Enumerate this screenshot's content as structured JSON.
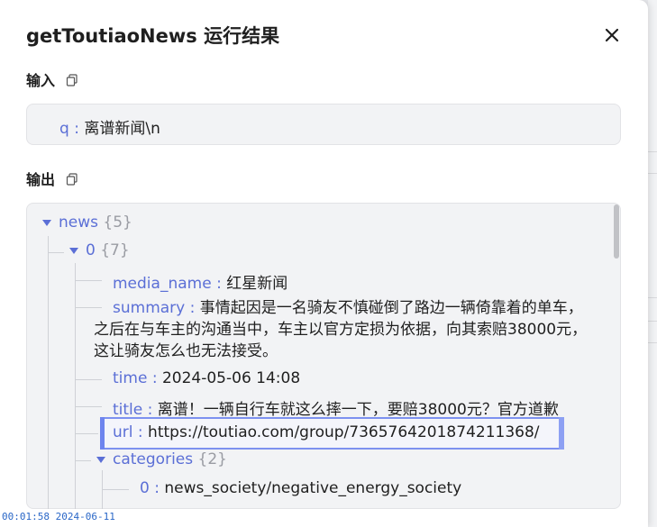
{
  "dialog": {
    "title": "getToutiaoNews 运行结果",
    "input_label": "输入",
    "output_label": "输出"
  },
  "input": {
    "key": "q",
    "separator": " : ",
    "value": "离谱新闻\\n"
  },
  "output": {
    "news_key": "news",
    "news_count": "{5}",
    "item0_key": "0",
    "item0_count": "{7}",
    "fields": {
      "media_name_key": "media_name",
      "media_name_value": "红星新闻",
      "summary_key": "summary",
      "summary_line1": "事情起因是一名骑友不慎碰倒了路边一辆倚靠着的单车，",
      "summary_line2": "之后在与车主的沟通当中，车主以官方定损为依据，向其索赔38000元，",
      "summary_line3": "这让骑友怎么也无法接受。",
      "time_key": "time",
      "time_value": "2024-05-06 14:08",
      "title_key": "title",
      "title_value": "离谱！一辆自行车就这么摔一下，要赔38000元？官方道歉",
      "url_key": "url",
      "url_value": "https://toutiao.com/group/7365764201874211368/",
      "categories_key": "categories",
      "categories_count": "{2}",
      "cat0_key": "0",
      "cat0_value": "news_society/negative_energy_society"
    },
    "separator": " : "
  },
  "overlay": {
    "timestamp": "00:01:58 2024-06-11"
  },
  "colors": {
    "key": "#5b6fd6",
    "value": "#1f1f1f",
    "count": "#9a9ca3",
    "highlight_border": "#7d91f0"
  },
  "icons": {
    "close": "close-icon",
    "copy": "copy-icon",
    "caret": "caret-down-icon"
  }
}
